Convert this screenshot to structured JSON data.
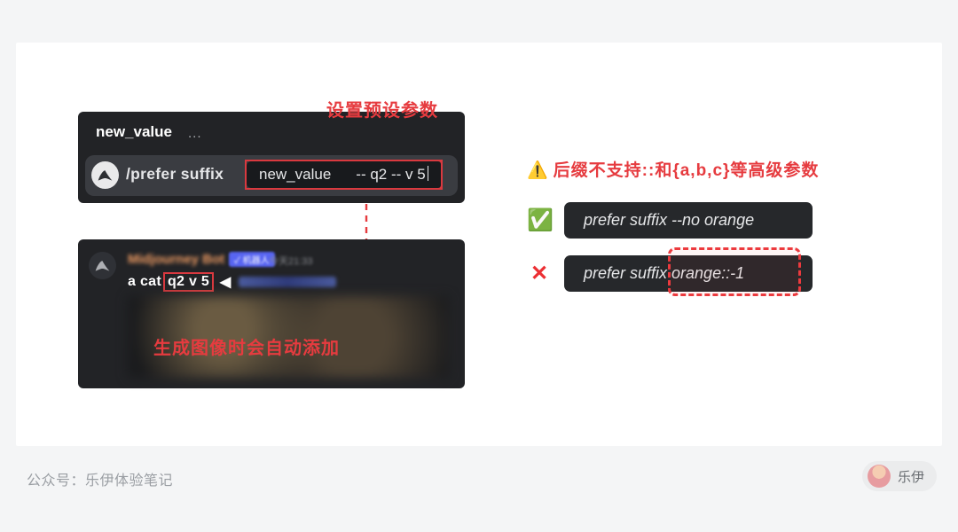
{
  "card": {
    "top_panel": {
      "field_label": "new_value",
      "ellipsis": "...",
      "command": "/prefer suffix",
      "pill_label": "new_value",
      "pill_value": "-- q2 -- v 5"
    },
    "annotation_top": "设置预设参数",
    "bot_panel": {
      "bot_name": "Midjourney Bot",
      "bot_badge": "✓ 机器人",
      "bot_time": "今天21:33",
      "prompt_plain": "a cat",
      "prompt_highlight": "q2 v 5"
    },
    "annotation_mid": "生成图像时会自动添加"
  },
  "rules": {
    "warning_icon": "⚠️",
    "title": "后缀不支持::和{a,b,c}等高级参数",
    "ok_icon": "✅",
    "ok_example": "prefer suffix --no orange",
    "bad_icon": "✕",
    "bad_example": "prefer suffix orange::-1"
  },
  "footer": {
    "left": "公众号：乐伊体验笔记",
    "author": "乐伊"
  }
}
